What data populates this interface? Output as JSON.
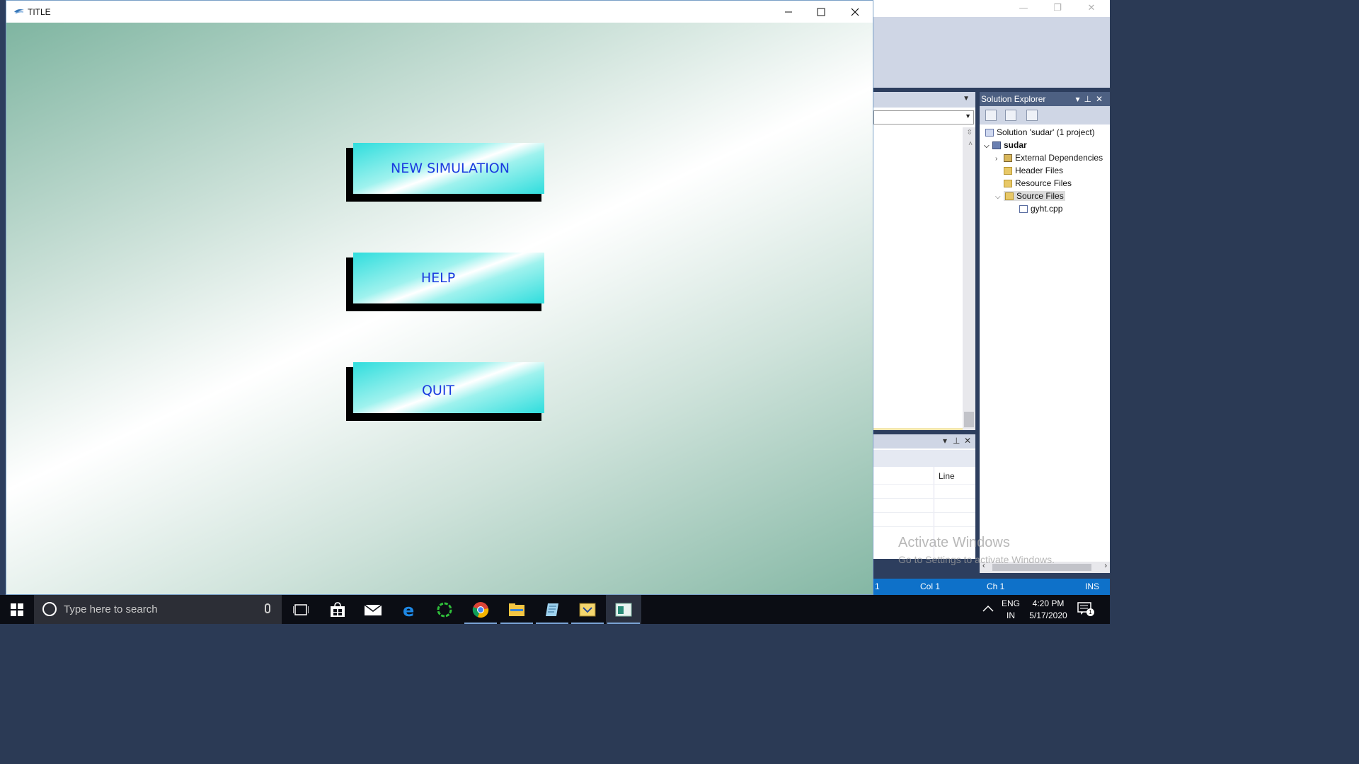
{
  "app_window": {
    "title": "TITLE",
    "controls": [
      "minimize",
      "maximize",
      "close"
    ]
  },
  "menu": {
    "new_simulation": "NEW SIMULATION",
    "help": "HELP",
    "quit": "QUIT"
  },
  "ide": {
    "solution_explorer": {
      "title": "Solution Explorer",
      "tree": [
        {
          "label": "Solution 'sudar' (1 project)",
          "icon": "solution-icon"
        },
        {
          "label": "sudar",
          "icon": "project-icon",
          "bold": true
        },
        {
          "label": "External Dependencies",
          "icon": "external-deps-icon"
        },
        {
          "label": "Header Files",
          "icon": "folder-icon"
        },
        {
          "label": "Resource Files",
          "icon": "folder-icon"
        },
        {
          "label": "Source Files",
          "icon": "folder-open-icon",
          "selected": true
        },
        {
          "label": "gyht.cpp",
          "icon": "cpp-file-icon"
        }
      ]
    },
    "output": {
      "column_line": "Line"
    },
    "status": {
      "ln": "1",
      "col": "Col 1",
      "ch": "Ch 1",
      "mode": "INS"
    },
    "watermark": {
      "line1": "Activate Windows",
      "line2": "Go to Settings to activate Windows."
    }
  },
  "taskbar": {
    "search_placeholder": "Type here to search",
    "apps": [
      "task-view-icon",
      "store-icon",
      "mail-icon",
      "edge-icon",
      "green-ring-icon",
      "chrome-icon",
      "file-explorer-icon",
      "notepad-icon",
      "visual-studio-icon",
      "app-window-icon"
    ],
    "lang_top": "ENG",
    "lang_bottom": "IN",
    "time": "4:20 PM",
    "date": "5/17/2020",
    "notification_count": "1"
  },
  "colors": {
    "button_text": "#1a3adf",
    "button_face": "#2fdddd",
    "background_green": "#7fb5a1",
    "statusbar": "#0e71c9"
  }
}
